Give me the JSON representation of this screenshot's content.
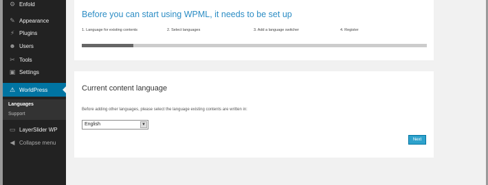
{
  "sidebar": {
    "items": [
      {
        "label": "Enfold",
        "icon": "gear-icon",
        "glyph": "⚙"
      },
      {
        "label": "Appearance",
        "icon": "brush-icon",
        "glyph": "✎"
      },
      {
        "label": "Plugins",
        "icon": "plug-icon",
        "glyph": "⚡"
      },
      {
        "label": "Users",
        "icon": "user-icon",
        "glyph": "☻"
      },
      {
        "label": "Tools",
        "icon": "wrench-icon",
        "glyph": "✂"
      },
      {
        "label": "Settings",
        "icon": "settings-icon",
        "glyph": "▣"
      },
      {
        "label": "WorldPress",
        "icon": "wpml-icon",
        "glyph": "⚠"
      },
      {
        "label": "LayerSlider WP",
        "icon": "layers-icon",
        "glyph": "▭"
      },
      {
        "label": "Collapse menu",
        "icon": "collapse-icon",
        "glyph": "◀"
      }
    ],
    "submenu": {
      "current": "Languages",
      "other": "Support"
    }
  },
  "setup": {
    "title": "Before you can start using WPML, it needs to be set up",
    "steps": [
      "1. Language for existing contents",
      "2. Select languages",
      "3. Add a language switcher",
      "4. Register"
    ],
    "progress": 0.15
  },
  "content": {
    "heading": "Current content language",
    "instruction": "Before adding other languages, please select the language existing contents are written in:",
    "selected_language": "English",
    "next_label": "Next"
  },
  "colors": {
    "accent": "#0074a2",
    "title_blue": "#2b8cc4",
    "button": "#2ea2cc"
  }
}
